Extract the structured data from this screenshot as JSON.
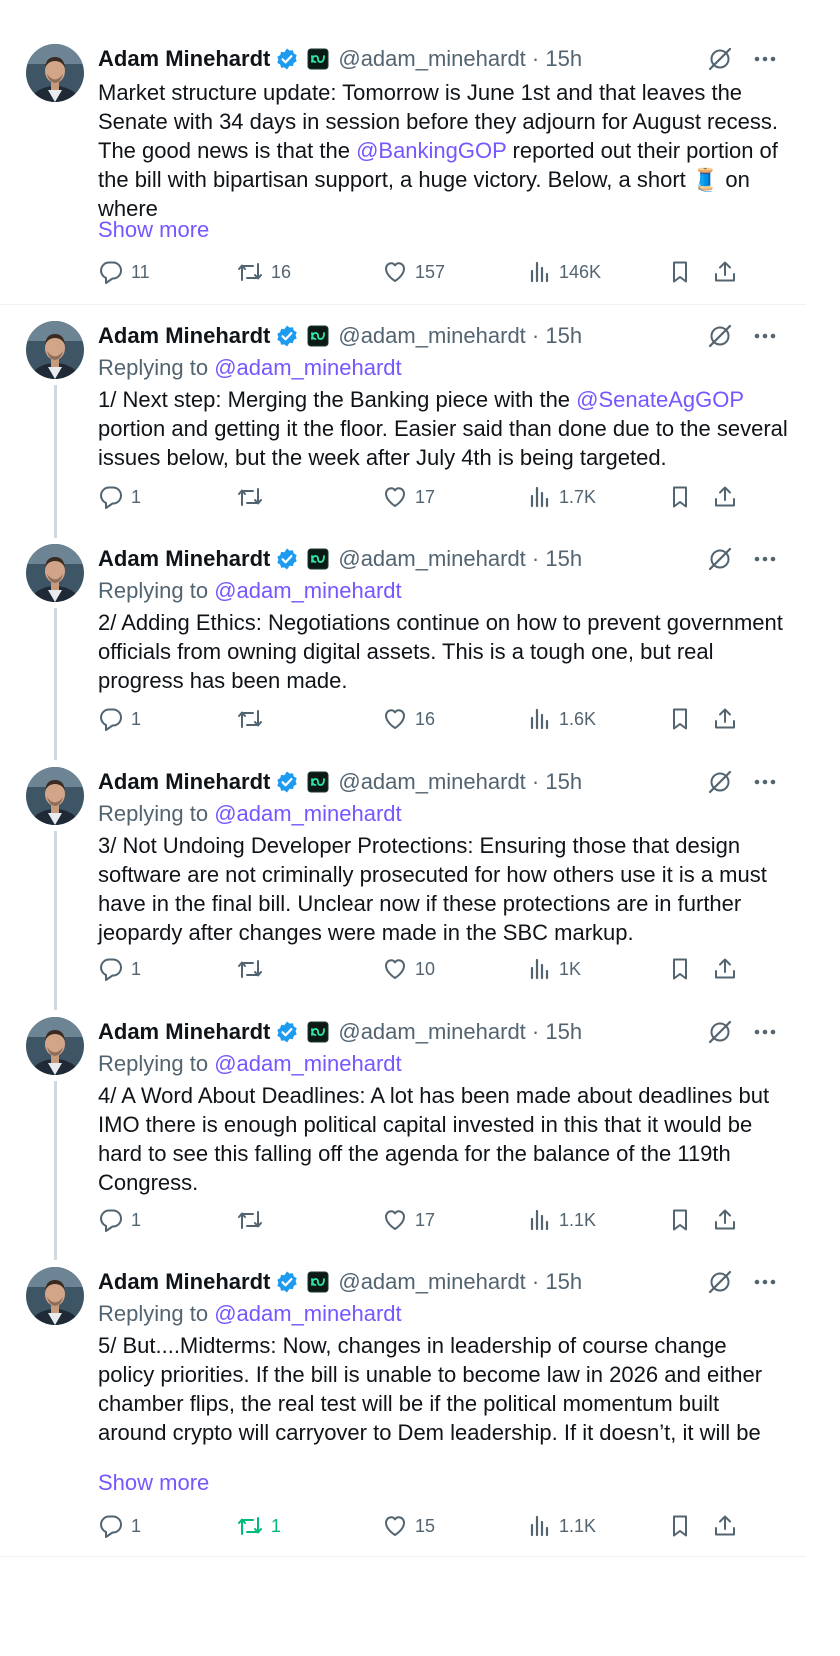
{
  "author": {
    "name": "Adam Minehardt",
    "handle": "@adam_minehardt",
    "time": "15h"
  },
  "replying_label": "Replying to",
  "show_more": "Show more",
  "colors": {
    "accent": "#7856ff",
    "verified": "#1d9bf0",
    "repost_active": "#00ba7c",
    "muted": "#536471"
  },
  "icons": [
    "verified-badge-icon",
    "affiliate-badge-icon",
    "grok-icon",
    "more-icon",
    "reply-icon",
    "repost-icon",
    "like-icon",
    "views-icon",
    "bookmark-icon",
    "share-icon"
  ],
  "posts": [
    {
      "body_1": "Market structure update: Tomorrow is June 1st and that leaves the Senate with 34 days in session before they adjourn for August recess. The good news is that the ",
      "mention": "@BankingGOP",
      "body_2": " reported out their portion of the bill with bipartisan support, a huge victory. Below, a short ",
      "emoji": "🧵",
      "body_3": " on where",
      "stats": {
        "replies": "11",
        "reposts": "16",
        "likes": "157",
        "views": "146K"
      }
    },
    {
      "reply_to": "@adam_minehardt",
      "body_1": "1/ Next step: Merging the Banking piece with the ",
      "mention": "@SenateAgGOP",
      "body_2": " portion and getting it the floor. Easier said than done due to the several issues below, but the week after July 4th is being targeted.",
      "stats": {
        "replies": "1",
        "reposts": "",
        "likes": "17",
        "views": "1.7K"
      }
    },
    {
      "reply_to": "@adam_minehardt",
      "body": "2/ Adding Ethics: Negotiations continue on how to prevent government officials from owning digital assets. This is a tough one, but real progress has been made.",
      "stats": {
        "replies": "1",
        "reposts": "",
        "likes": "16",
        "views": "1.6K"
      }
    },
    {
      "reply_to": "@adam_minehardt",
      "body": "3/ Not Undoing Developer Protections: Ensuring those that design software are not criminally prosecuted for how others use it is a must have in the final bill. Unclear now if these protections are in further jeopardy after changes were made in the SBC markup.",
      "stats": {
        "replies": "1",
        "reposts": "",
        "likes": "10",
        "views": "1K"
      }
    },
    {
      "reply_to": "@adam_minehardt",
      "body": "4/ A Word About Deadlines: A lot has been made about deadlines but IMO there is enough political capital invested in this that it would be hard to see this falling off the agenda for the balance of the 119th Congress.",
      "stats": {
        "replies": "1",
        "reposts": "",
        "likes": "17",
        "views": "1.1K"
      }
    },
    {
      "reply_to": "@adam_minehardt",
      "body": "5/ But....Midterms: Now, changes in leadership of course change policy priorities. If the bill is unable to become law in 2026 and either chamber flips, the real test will be if the political momentum built around crypto will carryover to Dem leadership. If it doesn’t, it will be",
      "stats": {
        "replies": "1",
        "reposts": "1",
        "likes": "15",
        "views": "1.1K"
      },
      "reposted": true
    }
  ]
}
